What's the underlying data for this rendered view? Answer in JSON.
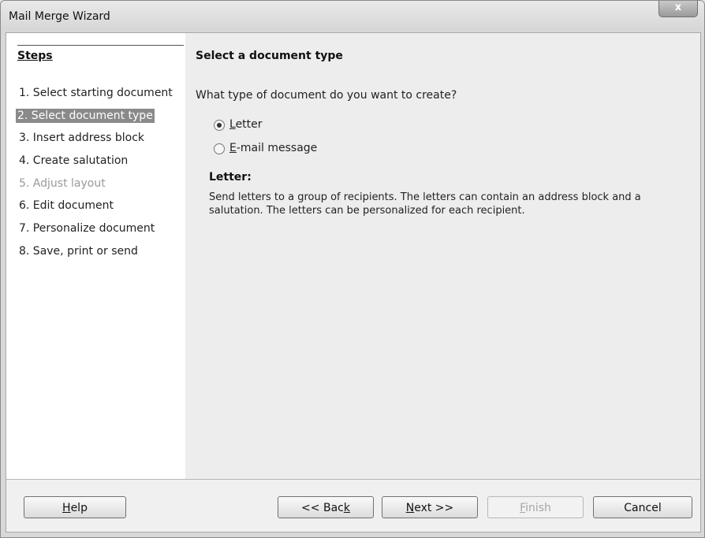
{
  "window": {
    "title": "Mail Merge Wizard",
    "close_label": "x"
  },
  "sidebar": {
    "heading": "Steps",
    "steps": [
      {
        "label": "1. Select starting document",
        "state": "normal"
      },
      {
        "label": "2. Select document type",
        "state": "active"
      },
      {
        "label": "3. Insert address block",
        "state": "normal"
      },
      {
        "label": "4. Create salutation",
        "state": "normal"
      },
      {
        "label": "5. Adjust layout",
        "state": "disabled"
      },
      {
        "label": "6. Edit document",
        "state": "normal"
      },
      {
        "label": "7. Personalize document",
        "state": "normal"
      },
      {
        "label": "8. Save, print or send",
        "state": "normal"
      }
    ]
  },
  "main": {
    "title": "Select a document type",
    "question": "What type of document do you want to create?",
    "options": [
      {
        "accel": "L",
        "rest": "etter",
        "selected": true
      },
      {
        "accel": "E",
        "rest": "-mail message",
        "selected": false
      }
    ],
    "description_title": "Letter:",
    "description": "Send letters to a group of recipients. The letters can contain an address block and a salutation. The letters can be personalized for each recipient."
  },
  "buttons": {
    "help": {
      "accel": "H",
      "rest": "elp"
    },
    "back": {
      "pre": "<< Bac",
      "accel": "k"
    },
    "next": {
      "accel": "N",
      "rest": "ext >>"
    },
    "finish": {
      "accel": "F",
      "rest": "inish",
      "enabled": false
    },
    "cancel": {
      "label": "Cancel"
    }
  },
  "colors": {
    "active_step_bg": "#8a8a8a",
    "disabled_text": "#9a9a9a"
  }
}
